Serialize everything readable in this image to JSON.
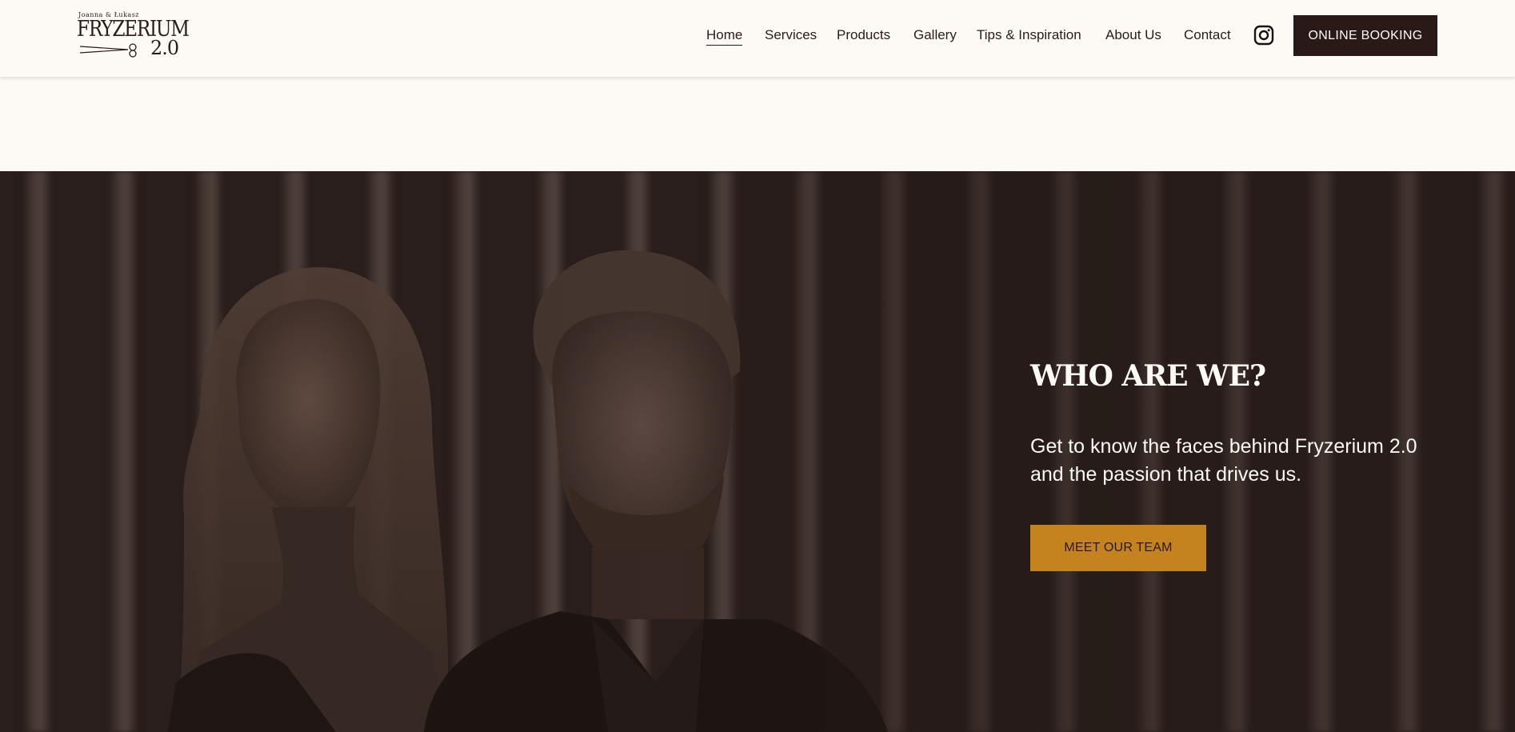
{
  "logo": {
    "tagline": "Joanna & Łukasz",
    "name": "FRYZERIUM",
    "version": "2.0"
  },
  "nav": {
    "items": [
      {
        "label": "Home",
        "active": true
      },
      {
        "label": "Services"
      },
      {
        "label": "Products"
      },
      {
        "label": "Gallery"
      },
      {
        "label": "Tips & Inspiration"
      },
      {
        "label": "About Us"
      },
      {
        "label": "Contact"
      }
    ],
    "social_icon": "instagram-icon",
    "cta_label": "ONLINE BOOKING"
  },
  "hero": {
    "title": "WHO ARE WE?",
    "text": "Get to know the faces behind Fryzerium 2.0 and the passion that drives us.",
    "button_label": "MEET OUR TEAM"
  },
  "colors": {
    "background": "#fdf9f5",
    "dark": "#2a1a17",
    "accent": "#c4831f"
  }
}
